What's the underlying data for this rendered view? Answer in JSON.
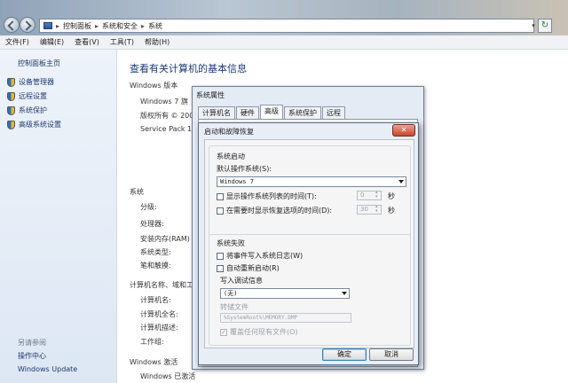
{
  "address": {
    "crumbs": [
      "控制面板",
      "系统和安全",
      "系统"
    ]
  },
  "menu": [
    "文件(F)",
    "编辑(E)",
    "查看(V)",
    "工具(T)",
    "帮助(H)"
  ],
  "sidebar": {
    "home": "控制面板主页",
    "items": [
      "设备管理器",
      "远程设置",
      "系统保护",
      "高级系统设置"
    ],
    "see_also": "另请参阅",
    "links": [
      "操作中心",
      "Windows Update"
    ]
  },
  "main": {
    "title": "查看有关计算机的基本信息",
    "edition_header": "Windows 版本",
    "edition_lines": [
      "Windows 7 旗",
      "版权所有 © 200",
      "Service Pack 1"
    ],
    "system_header": "系统",
    "system_labels": [
      "分级:",
      "处理器:",
      "安装内存(RAM)",
      "系统类型:",
      "笔和触摸:"
    ],
    "computer_header": "计算机名称、域和工",
    "computer_labels": [
      "计算机名:",
      "计算机全名:",
      "计算机描述:",
      "工作组:"
    ],
    "activation_header": "Windows 激活",
    "activation_line": "Windows 已激活"
  },
  "sysprop": {
    "title": "系统属性",
    "tabs": [
      "计算机名",
      "硬件",
      "高级",
      "系统保护",
      "远程"
    ],
    "active_tab": "高级"
  },
  "dialog": {
    "title": "启动和故障恢复",
    "close": "✕",
    "startup_header": "系统启动",
    "default_os_label": "默认操作系统(S):",
    "default_os_value": "Windows 7",
    "show_list_label": "显示操作系统列表的时间(T):",
    "show_list_value": "0",
    "show_recovery_label": "在需要时显示恢复选项的时间(D):",
    "show_recovery_value": "30",
    "seconds": "秒",
    "failure_header": "系统失败",
    "write_event_label": "将事件写入系统日志(W)",
    "auto_restart_label": "自动重新启动(R)",
    "debug_header": "写入调试信息",
    "debug_value": "(无)",
    "dump_file_label": "转储文件",
    "dump_file_value": "%SystemRoot%\\MEMORY.DMP",
    "overwrite_label": "覆盖任何现有文件(O)",
    "ok": "确定",
    "cancel": "取消"
  }
}
